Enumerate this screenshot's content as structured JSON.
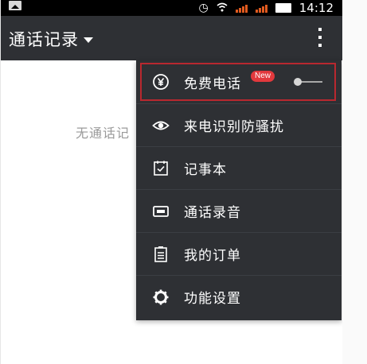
{
  "status_bar": {
    "time": "14:12",
    "signal_icon": "cell-signal",
    "wifi_icon": "wifi",
    "alarm_icon": "alarm-clock",
    "battery_icon": "battery"
  },
  "app_bar": {
    "title": "通话记录",
    "dropdown_icon": "caret-down",
    "more_icon": "overflow-menu"
  },
  "content": {
    "empty_text": "无通话记"
  },
  "menu": {
    "items": [
      {
        "label": "免费电话",
        "icon": "yen-circle",
        "badge": "New",
        "toggle_on": false
      },
      {
        "label": "来电识别防骚扰",
        "icon": "eye"
      },
      {
        "label": "记事本",
        "icon": "notebook"
      },
      {
        "label": "通话录音",
        "icon": "cassette-tape"
      },
      {
        "label": "我的订单",
        "icon": "clipboard-list"
      },
      {
        "label": "功能设置",
        "icon": "gear"
      }
    ]
  },
  "colors": {
    "appbar_bg": "#2e3034",
    "menu_bg": "#2e3034",
    "highlight_border": "#b9282f",
    "badge_bg": "#e2393d"
  }
}
